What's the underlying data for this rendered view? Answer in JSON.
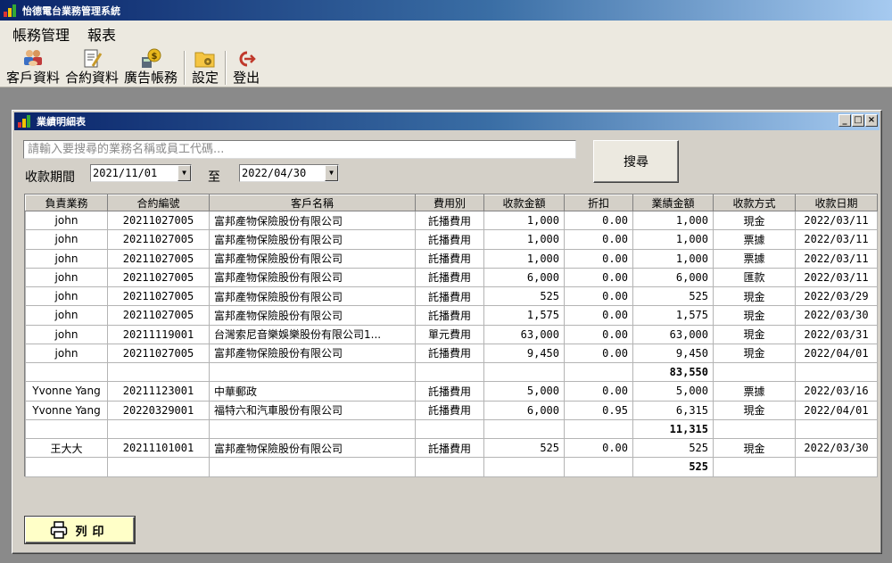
{
  "app": {
    "title": "怡德電台業務管理系統"
  },
  "menu": [
    "帳務管理",
    "報表"
  ],
  "toolbar": {
    "customers": "客戶資料",
    "contracts": "合約資料",
    "ad_accounts": "廣告帳務",
    "settings": "設定",
    "logout": "登出"
  },
  "window": {
    "title": "業績明細表",
    "controls": {
      "minimize": "_",
      "restore": "□",
      "close": "×"
    }
  },
  "search": {
    "placeholder": "請輸入要搜尋的業務名稱或員工代碼...",
    "button": "搜尋"
  },
  "period": {
    "label": "收款期間",
    "from": "2021/11/01",
    "to_label": "至",
    "to": "2022/04/30",
    "dropdown_glyph": "▼"
  },
  "grid": {
    "columns": [
      "負責業務",
      "合約編號",
      "客戶名稱",
      "費用別",
      "收款金額",
      "折扣",
      "業績金額",
      "收款方式",
      "收款日期"
    ],
    "rows": [
      {
        "rep": "john",
        "contract": "20211027005",
        "client": "富邦產物保險股份有限公司",
        "fee": "託播費用",
        "amount": "1,000",
        "discount": "0.00",
        "sales": "1,000",
        "method": "現金",
        "date": "2022/03/11"
      },
      {
        "rep": "john",
        "contract": "20211027005",
        "client": "富邦產物保險股份有限公司",
        "fee": "託播費用",
        "amount": "1,000",
        "discount": "0.00",
        "sales": "1,000",
        "method": "票據",
        "date": "2022/03/11"
      },
      {
        "rep": "john",
        "contract": "20211027005",
        "client": "富邦產物保險股份有限公司",
        "fee": "託播費用",
        "amount": "1,000",
        "discount": "0.00",
        "sales": "1,000",
        "method": "票據",
        "date": "2022/03/11"
      },
      {
        "rep": "john",
        "contract": "20211027005",
        "client": "富邦產物保險股份有限公司",
        "fee": "託播費用",
        "amount": "6,000",
        "discount": "0.00",
        "sales": "6,000",
        "method": "匯款",
        "date": "2022/03/11"
      },
      {
        "rep": "john",
        "contract": "20211027005",
        "client": "富邦產物保險股份有限公司",
        "fee": "託播費用",
        "amount": "525",
        "discount": "0.00",
        "sales": "525",
        "method": "現金",
        "date": "2022/03/29"
      },
      {
        "rep": "john",
        "contract": "20211027005",
        "client": "富邦產物保險股份有限公司",
        "fee": "託播費用",
        "amount": "1,575",
        "discount": "0.00",
        "sales": "1,575",
        "method": "現金",
        "date": "2022/03/30"
      },
      {
        "rep": "john",
        "contract": "20211119001",
        "client": "台灣索尼音樂娛樂股份有限公司1...",
        "fee": "單元費用",
        "amount": "63,000",
        "discount": "0.00",
        "sales": "63,000",
        "method": "現金",
        "date": "2022/03/31"
      },
      {
        "rep": "john",
        "contract": "20211027005",
        "client": "富邦產物保險股份有限公司",
        "fee": "託播費用",
        "amount": "9,450",
        "discount": "0.00",
        "sales": "9,450",
        "method": "現金",
        "date": "2022/04/01"
      },
      {
        "subtotal": "83,550"
      },
      {
        "rep": "Yvonne Yang",
        "contract": "20211123001",
        "client": "中華郵政",
        "fee": "託播費用",
        "amount": "5,000",
        "discount": "0.00",
        "sales": "5,000",
        "method": "票據",
        "date": "2022/03/16"
      },
      {
        "rep": "Yvonne Yang",
        "contract": "20220329001",
        "client": "福特六和汽車股份有限公司",
        "fee": "託播費用",
        "amount": "6,000",
        "discount": "0.95",
        "sales": "6,315",
        "method": "現金",
        "date": "2022/04/01"
      },
      {
        "subtotal": "11,315"
      },
      {
        "rep": "王大大",
        "contract": "20211101001",
        "client": "富邦產物保險股份有限公司",
        "fee": "託播費用",
        "amount": "525",
        "discount": "0.00",
        "sales": "525",
        "method": "現金",
        "date": "2022/03/30"
      },
      {
        "subtotal": "525"
      }
    ]
  },
  "print": {
    "label": "列印"
  },
  "colors": {
    "title_start": "#0a246a",
    "title_end": "#a6caf0",
    "subtotal": "#2a2aa8",
    "print_bg": "#ffffc8"
  }
}
